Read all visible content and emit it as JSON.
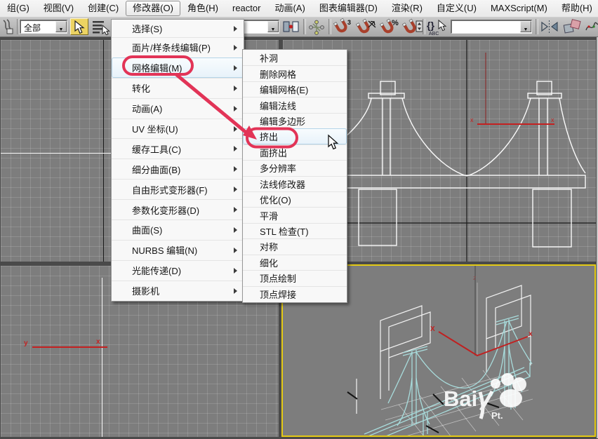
{
  "menu_bar": {
    "items": [
      {
        "label": "组(G)"
      },
      {
        "label": "视图(V)"
      },
      {
        "label": "创建(C)"
      },
      {
        "label": "修改器(O)",
        "active": true
      },
      {
        "label": "角色(H)"
      },
      {
        "label": "reactor"
      },
      {
        "label": "动画(A)"
      },
      {
        "label": "图表编辑器(D)"
      },
      {
        "label": "渲染(R)"
      },
      {
        "label": "自定义(U)"
      },
      {
        "label": "MAXScript(M)"
      },
      {
        "label": "帮助(H)"
      }
    ]
  },
  "toolbar": {
    "selection_filter": {
      "value": "全部"
    },
    "partial_dropdown": {
      "value": ""
    },
    "named_selection_dropdown": {
      "value": ""
    },
    "snap_3d_label": "3",
    "percent_snap_label": "%",
    "braces_label": "{}",
    "abc_label": "ABC",
    "dropdown_arrow": "▼"
  },
  "modifier_menu": {
    "items": [
      {
        "label": "选择(S)"
      },
      {
        "label": "面片/样条线编辑(P)"
      },
      {
        "label": "网格编辑(M)",
        "hover": true
      },
      {
        "label": "转化"
      },
      {
        "label": "动画(A)"
      },
      {
        "label": "UV 坐标(U)"
      },
      {
        "label": "缓存工具(C)"
      },
      {
        "label": "细分曲面(B)"
      },
      {
        "label": "自由形式变形器(F)"
      },
      {
        "label": "参数化变形器(D)"
      },
      {
        "label": "曲面(S)"
      },
      {
        "label": "NURBS 编辑(N)"
      },
      {
        "label": "光能传递(D)"
      },
      {
        "label": "摄影机"
      }
    ]
  },
  "mesh_edit_submenu": {
    "items": [
      {
        "label": "补洞"
      },
      {
        "label": "删除网格"
      },
      {
        "label": "编辑网格(E)"
      },
      {
        "label": "编辑法线"
      },
      {
        "label": "编辑多边形"
      },
      {
        "label": "挤出",
        "hover": true
      },
      {
        "label": "面挤出"
      },
      {
        "label": "多分辨率"
      },
      {
        "label": "法线修改器"
      },
      {
        "label": "优化(O)"
      },
      {
        "label": "平滑"
      },
      {
        "label": "STL 检查(T)"
      },
      {
        "label": "对称"
      },
      {
        "label": "细化"
      },
      {
        "label": "顶点绘制"
      },
      {
        "label": "顶点焊接"
      }
    ]
  },
  "viewport": {
    "axis": {
      "x": "x",
      "y": "y",
      "z": "z",
      "x_upper": "X"
    },
    "watermark": {
      "text": "Bai",
      "sub": "Pt."
    }
  },
  "annotations": {
    "circled_menu_item": "网格编辑(M)",
    "circled_submenu_item": "挤出",
    "color": "#e23457"
  },
  "colors": {
    "annotation_red": "#e23457",
    "active_viewport_border": "#e4ca14",
    "select_button_active": "#ecd362",
    "viewport_bg": "#7d7d7d"
  }
}
